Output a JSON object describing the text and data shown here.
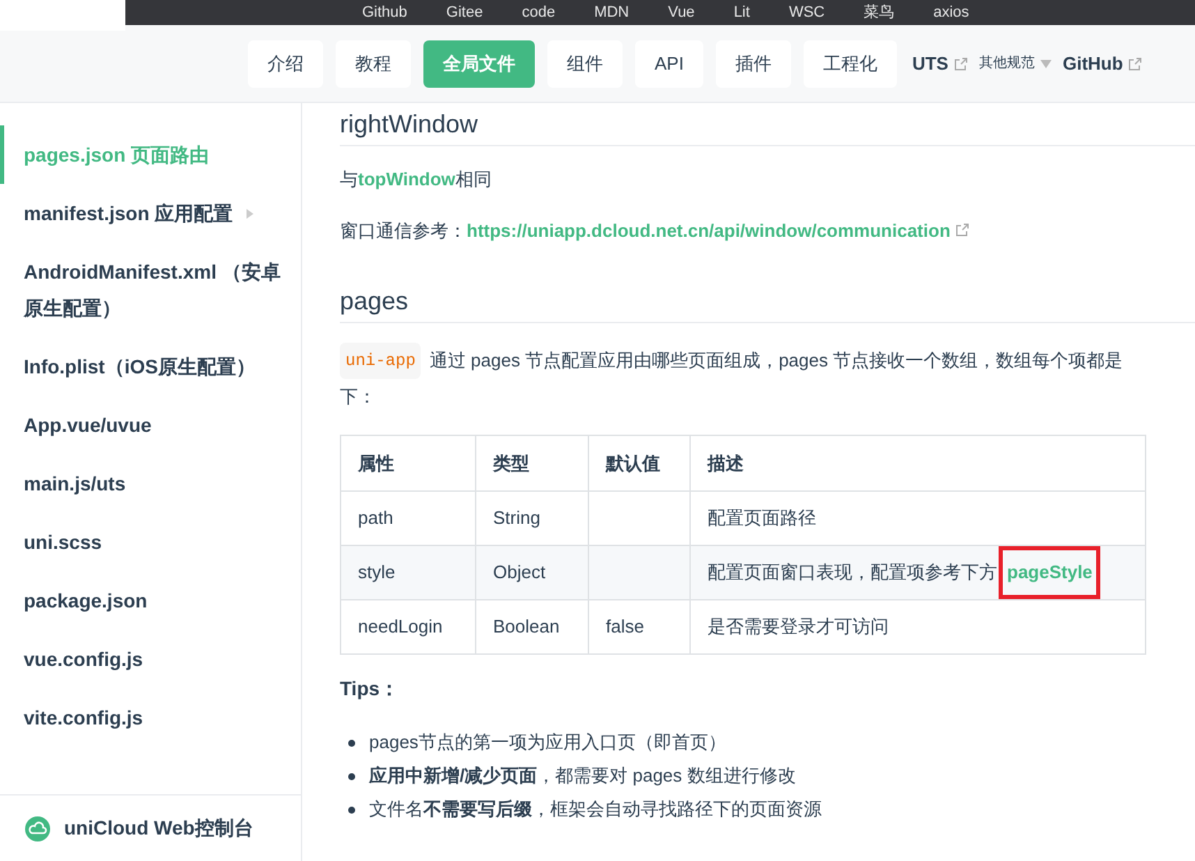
{
  "bookmarks": [
    {
      "label": "Github"
    },
    {
      "label": "Gitee"
    },
    {
      "label": "code"
    },
    {
      "label": "MDN"
    },
    {
      "label": "Vue"
    },
    {
      "label": "Lit"
    },
    {
      "label": "WSC"
    },
    {
      "label": "菜鸟"
    },
    {
      "label": "axios"
    }
  ],
  "nav": {
    "items": [
      {
        "label": "介绍",
        "selected": false
      },
      {
        "label": "教程",
        "selected": false
      },
      {
        "label": "全局文件",
        "selected": true
      },
      {
        "label": "组件",
        "selected": false
      },
      {
        "label": "API",
        "selected": false
      },
      {
        "label": "插件",
        "selected": false
      },
      {
        "label": "工程化",
        "selected": false
      }
    ],
    "links": [
      {
        "label": "UTS",
        "kind": "external"
      },
      {
        "label": "其他规范",
        "kind": "dropdown"
      },
      {
        "label": "GitHub",
        "kind": "external"
      }
    ]
  },
  "sidebar": {
    "items": [
      {
        "label": "pages.json 页面路由",
        "selected": true,
        "expandable": false
      },
      {
        "label": "manifest.json 应用配置",
        "selected": false,
        "expandable": true
      },
      {
        "label": "AndroidManifest.xml （安卓原生配置）",
        "selected": false,
        "expandable": false
      },
      {
        "label": "Info.plist（iOS原生配置）",
        "selected": false,
        "expandable": false
      },
      {
        "label": "App.vue/uvue",
        "selected": false,
        "expandable": false
      },
      {
        "label": "main.js/uts",
        "selected": false,
        "expandable": false
      },
      {
        "label": "uni.scss",
        "selected": false,
        "expandable": false
      },
      {
        "label": "package.json",
        "selected": false,
        "expandable": false
      },
      {
        "label": "vue.config.js",
        "selected": false,
        "expandable": false
      },
      {
        "label": "vite.config.js",
        "selected": false,
        "expandable": false
      }
    ],
    "footer_link": "uniCloud Web控制台"
  },
  "content": {
    "section_1": {
      "heading": "rightWindow",
      "same_as": {
        "before": "与",
        "link": "topWindow",
        "after": "相同"
      },
      "reference": {
        "label": "窗口通信参考：",
        "link": "https://uniapp.dcloud.net.cn/api/window/communication"
      }
    },
    "section_2": {
      "heading": "pages",
      "intro": {
        "code": "uni-app",
        "text": "通过 pages 节点配置应用由哪些页面组成，pages 节点接收一个数组，数组每个项都是",
        "continuation": "下："
      },
      "table": {
        "columns": [
          "属性",
          "类型",
          "默认值",
          "描述"
        ],
        "rows": [
          {
            "cells": [
              "path",
              "String",
              "",
              "配置页面路径"
            ]
          },
          {
            "cells": [
              "style",
              "Object",
              "",
              "配置页面窗口表现，配置项参考下方"
            ],
            "link": "pageStyle",
            "highlighted": true
          },
          {
            "cells": [
              "needLogin",
              "Boolean",
              "false",
              "是否需要登录才可访问"
            ]
          }
        ]
      },
      "tips_title": "Tips：",
      "tips": [
        "pages节点的第一项为应用入口页（即首页）",
        "**应用中新增/减少页面**，都需要对 pages 数组进行修改",
        "文件名**不需要写后缀**，框架会自动寻找路径下的页面资源"
      ]
    }
  }
}
